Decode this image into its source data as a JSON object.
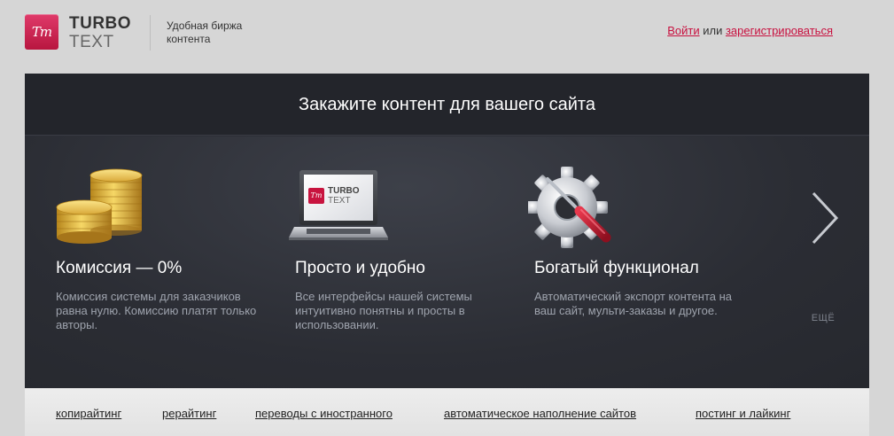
{
  "header": {
    "logo_badge": "Tт",
    "logo_line1": "TURBO",
    "logo_line2": "TEXT",
    "tagline": "Удобная биржа контента",
    "login_link": "Войти",
    "or_text": "или",
    "register_link": "зарегистрироваться"
  },
  "panel": {
    "title": "Закажите контент для вашего сайта",
    "features": [
      {
        "icon": "coins-icon",
        "title": "Комиссия — 0%",
        "desc": "Комиссия системы для заказчиков равна нулю. Комиссию платят только авторы."
      },
      {
        "icon": "laptop-icon",
        "title": "Просто и удобно",
        "desc": "Все интерфейсы нашей системы интуитивно понятны и просты в использовании.",
        "screen_badge": "Tт",
        "screen_line1": "TURBO",
        "screen_line2": "TEXT"
      },
      {
        "icon": "gear-screwdriver-icon",
        "title": "Богатый функционал",
        "desc": "Автоматический экспорт контента на ваш сайт, мульти-заказы и другое."
      }
    ],
    "more_label": "ЕЩЁ"
  },
  "bottom_nav": [
    "копирайтинг",
    "рерайтинг",
    "переводы с иностранного",
    "автоматическое наполнение сайтов",
    "постинг и лайкинг"
  ],
  "colors": {
    "accent": "#c8103f",
    "panel_bg": "#2a2c33",
    "page_bg": "#d6d6d6"
  }
}
